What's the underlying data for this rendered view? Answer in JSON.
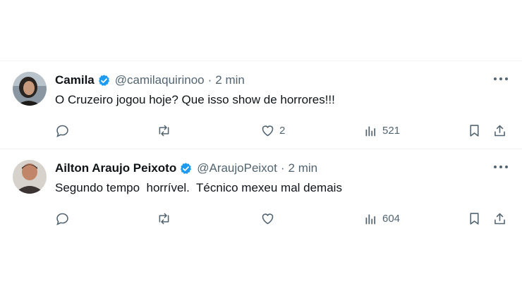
{
  "tweets": [
    {
      "author": "Camila",
      "handle": "@camilaquirinoo",
      "separator": "·",
      "time": "2 min",
      "text": "O Cruzeiro jogou hoje? Que isso show de horrores!!!",
      "likes": "2",
      "views": "521"
    },
    {
      "author": "Ailton Araujo Peixoto",
      "handle": "@AraujoPeixot",
      "separator": "·",
      "time": "2 min",
      "text": "Segundo tempo  horrível.  Técnico mexeu mal demais",
      "likes": "",
      "views": "604"
    }
  ],
  "colors": {
    "verified": "#1d9bf0",
    "text": "#0f1419",
    "secondary": "#536471",
    "divider": "#eff3f4"
  },
  "icons": [
    "verified-badge-icon",
    "more-icon",
    "reply-icon",
    "retweet-icon",
    "like-icon",
    "views-icon",
    "bookmark-icon",
    "share-icon"
  ]
}
